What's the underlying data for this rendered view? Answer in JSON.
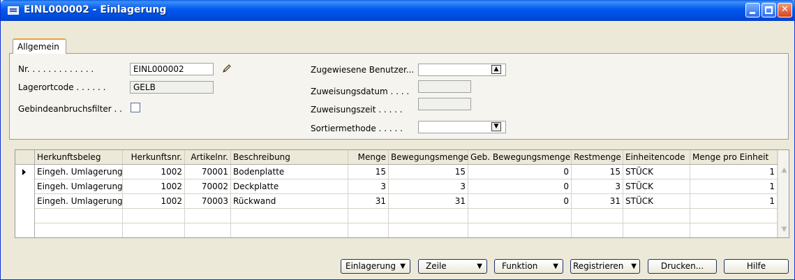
{
  "window": {
    "title": "EINL000002 - Einlagerung"
  },
  "tabs": [
    {
      "label": "Allgemein"
    }
  ],
  "form": {
    "nr_label": "Nr. . . . . . . . . . . . .",
    "nr_value": "EINL000002",
    "lagerortcode_label": "Lagerortcode . . . . . .",
    "lagerortcode_value": "GELB",
    "gebindeanbruchsfilter_label": "Gebindeanbruchsfilter . .",
    "gebindeanbruchsfilter_checked": false,
    "zugewiesene_benutzer_label": "Zugewiesene Benutzer...",
    "zugewiesene_benutzer_value": "",
    "zuweisungsdatum_label": "Zuweisungsdatum . . . .",
    "zuweisungsdatum_value": "",
    "zuweisungszeit_label": "Zuweisungszeit . . . . .",
    "zuweisungszeit_value": "",
    "sortiermethode_label": "Sortiermethode . . . . .",
    "sortiermethode_value": ""
  },
  "table": {
    "columns": [
      "Herkunftsbeleg",
      "Herkunftsnr.",
      "Artikelnr.",
      "Beschreibung",
      "Menge",
      "Bewegungsmenge",
      "Geb. Bewegungsmenge",
      "Restmenge",
      "Einheitencode",
      "Menge pro Einheit"
    ],
    "rows": [
      [
        "Eingeh. Umlagerung",
        "1002",
        "70001",
        "Bodenplatte",
        "15",
        "15",
        "0",
        "15",
        "STÜCK",
        "1"
      ],
      [
        "Eingeh. Umlagerung",
        "1002",
        "70002",
        "Deckplatte",
        "3",
        "3",
        "0",
        "3",
        "STÜCK",
        "1"
      ],
      [
        "Eingeh. Umlagerung",
        "1002",
        "70003",
        "Rückwand",
        "31",
        "31",
        "0",
        "31",
        "STÜCK",
        "1"
      ]
    ]
  },
  "buttons": {
    "einlagerung": "Einlagerung",
    "zeile": "Zeile",
    "funktion": "Funktion",
    "registrieren": "Registrieren",
    "drucken": "Drucken...",
    "hilfe": "Hilfe"
  },
  "colors": {
    "titlebar": "#0058ee",
    "tab_accent": "#f0a030",
    "window_bg": "#ece9d8"
  },
  "icons": [
    "window-icon",
    "minimize-icon",
    "maximize-icon",
    "close-icon",
    "pencil-icon",
    "lookup-arrow-icon",
    "dropdown-arrow-icon",
    "row-pointer-icon",
    "scroll-up-icon",
    "scroll-down-icon"
  ]
}
